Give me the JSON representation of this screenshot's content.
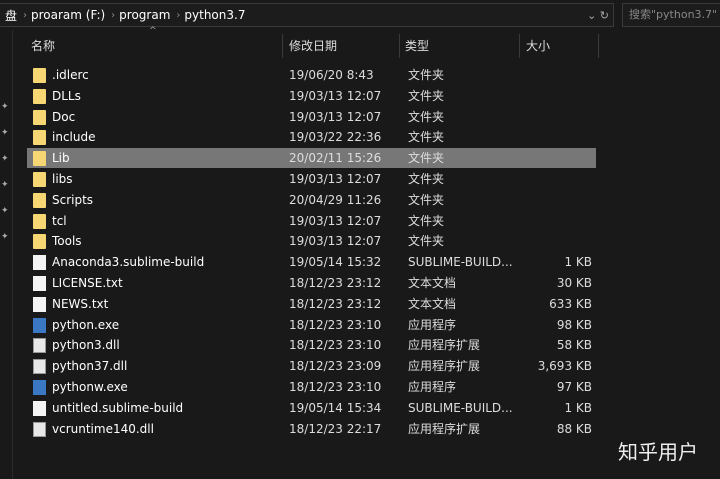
{
  "breadcrumb": [
    "盘",
    "proaram (F:)",
    "program",
    "python3.7"
  ],
  "search_placeholder": "搜索\"python3.7\"",
  "columns": {
    "name": "名称",
    "date": "修改日期",
    "type": "类型",
    "size": "大小"
  },
  "files": [
    {
      "name": ".idlerc",
      "date": "19/06/20 8:43",
      "type": "文件夹",
      "size": "",
      "icon": "folder"
    },
    {
      "name": "DLLs",
      "date": "19/03/13 12:07",
      "type": "文件夹",
      "size": "",
      "icon": "folder"
    },
    {
      "name": "Doc",
      "date": "19/03/13 12:07",
      "type": "文件夹",
      "size": "",
      "icon": "folder"
    },
    {
      "name": "include",
      "date": "19/03/22 22:36",
      "type": "文件夹",
      "size": "",
      "icon": "folder"
    },
    {
      "name": "Lib",
      "date": "20/02/11 15:26",
      "type": "文件夹",
      "size": "",
      "icon": "folder",
      "selected": true
    },
    {
      "name": "libs",
      "date": "19/03/13 12:07",
      "type": "文件夹",
      "size": "",
      "icon": "folder"
    },
    {
      "name": "Scripts",
      "date": "20/04/29 11:26",
      "type": "文件夹",
      "size": "",
      "icon": "folder"
    },
    {
      "name": "tcl",
      "date": "19/03/13 12:07",
      "type": "文件夹",
      "size": "",
      "icon": "folder"
    },
    {
      "name": "Tools",
      "date": "19/03/13 12:07",
      "type": "文件夹",
      "size": "",
      "icon": "folder"
    },
    {
      "name": "Anaconda3.sublime-build",
      "date": "19/05/14 15:32",
      "type": "SUBLIME-BUILD...",
      "size": "1 KB",
      "icon": "file"
    },
    {
      "name": "LICENSE.txt",
      "date": "18/12/23 23:12",
      "type": "文本文档",
      "size": "30 KB",
      "icon": "file"
    },
    {
      "name": "NEWS.txt",
      "date": "18/12/23 23:12",
      "type": "文本文档",
      "size": "633 KB",
      "icon": "file"
    },
    {
      "name": "python.exe",
      "date": "18/12/23 23:10",
      "type": "应用程序",
      "size": "98 KB",
      "icon": "exe"
    },
    {
      "name": "python3.dll",
      "date": "18/12/23 23:10",
      "type": "应用程序扩展",
      "size": "58 KB",
      "icon": "dll"
    },
    {
      "name": "python37.dll",
      "date": "18/12/23 23:09",
      "type": "应用程序扩展",
      "size": "3,693 KB",
      "icon": "dll"
    },
    {
      "name": "pythonw.exe",
      "date": "18/12/23 23:10",
      "type": "应用程序",
      "size": "97 KB",
      "icon": "exe"
    },
    {
      "name": "untitled.sublime-build",
      "date": "19/05/14 15:34",
      "type": "SUBLIME-BUILD...",
      "size": "1 KB",
      "icon": "file"
    },
    {
      "name": "vcruntime140.dll",
      "date": "18/12/23 22:17",
      "type": "应用程序扩展",
      "size": "88 KB",
      "icon": "dll"
    }
  ],
  "watermark": "知乎用户"
}
